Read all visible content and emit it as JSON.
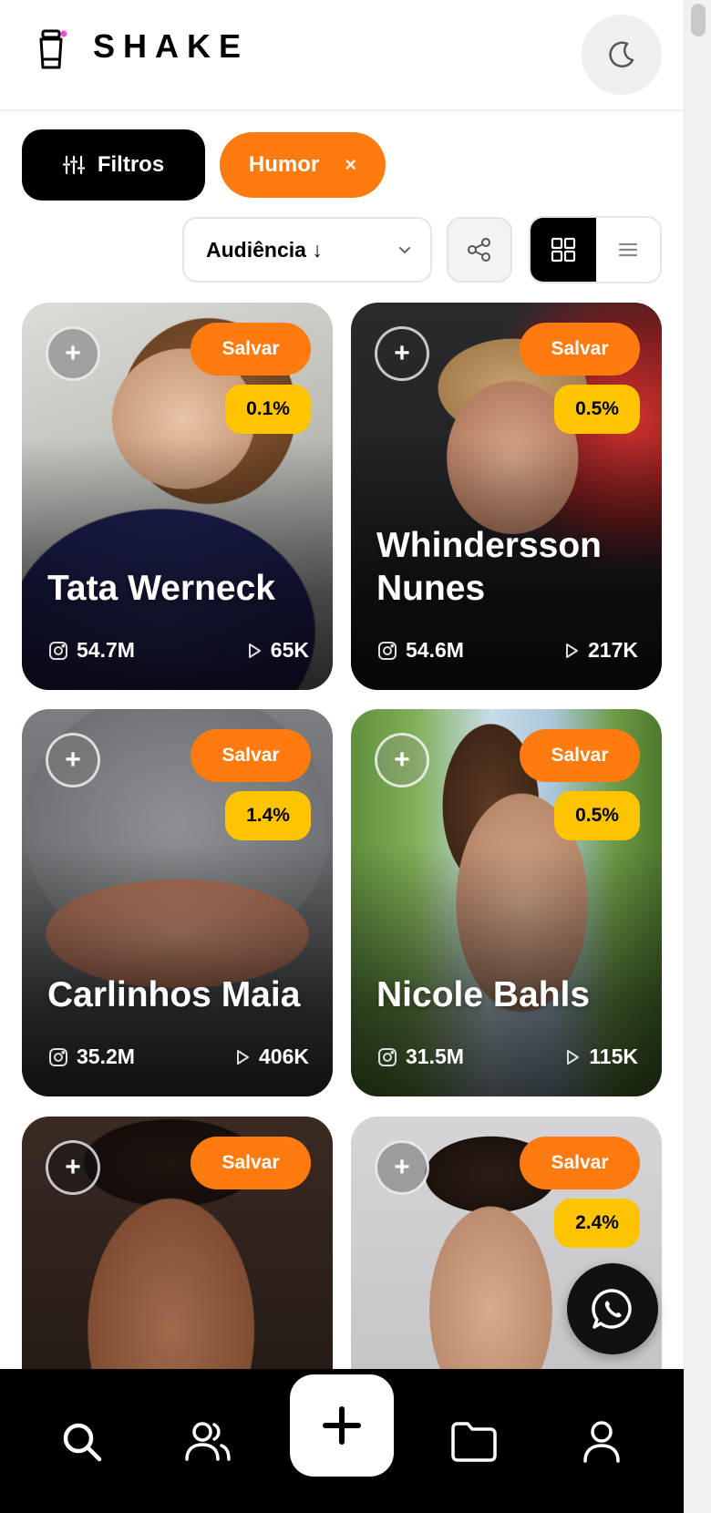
{
  "header": {
    "brand": "SHAKE",
    "logo_icon": "shaker-cup-icon",
    "theme_icon": "moon-icon"
  },
  "filters": {
    "filters_label": "Filtros",
    "active_chip": "Humor",
    "chip_remove": "×"
  },
  "controls": {
    "sort_label": "Audiência ↓",
    "view_mode": "grid"
  },
  "colors": {
    "accent_orange": "#ff7a0f",
    "badge_yellow": "#ffc400",
    "dark": "#000000"
  },
  "cards": [
    {
      "name": "Tata Werneck",
      "save": "Salvar",
      "rate": "0.1%",
      "instagram": "54.7M",
      "views": "65K"
    },
    {
      "name": "Whindersson Nunes",
      "save": "Salvar",
      "rate": "0.5%",
      "instagram": "54.6M",
      "views": "217K"
    },
    {
      "name": "Carlinhos Maia",
      "save": "Salvar",
      "rate": "1.4%",
      "instagram": "35.2M",
      "views": "406K"
    },
    {
      "name": "Nicole Bahls",
      "save": "Salvar",
      "rate": "0.5%",
      "instagram": "31.5M",
      "views": "115K"
    },
    {
      "name": "",
      "save": "Salvar",
      "rate": "",
      "instagram": "",
      "views": ""
    },
    {
      "name": "",
      "save": "Salvar",
      "rate": "2.4%",
      "instagram": "",
      "views": ""
    }
  ],
  "floating": {
    "icon": "whatsapp-icon"
  },
  "bottom_nav": {
    "items": [
      "search-icon",
      "users-icon",
      "plus-icon",
      "folder-icon",
      "profile-icon"
    ]
  }
}
